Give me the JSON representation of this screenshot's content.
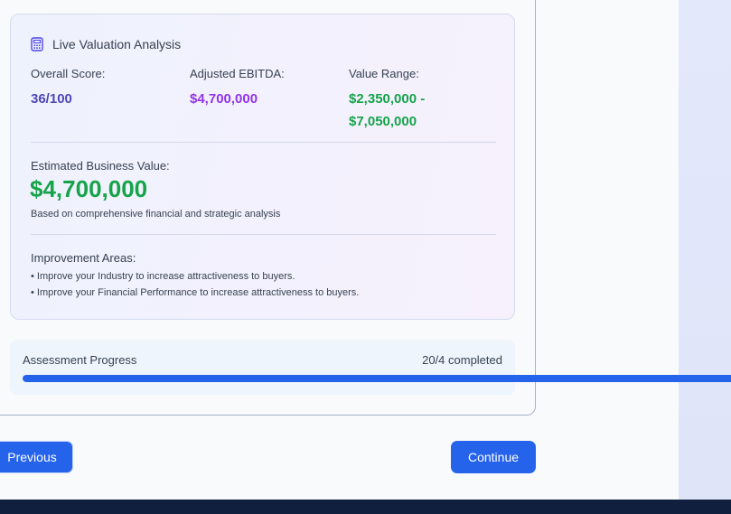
{
  "valuation": {
    "title": "Live Valuation Analysis",
    "icon": "calculator-icon",
    "overall_score_label": "Overall Score:",
    "overall_score_value": "36/100",
    "ebitda_label": "Adjusted EBITDA:",
    "ebitda_value": "$4,700,000",
    "range_label": "Value Range:",
    "range_value_low": "$2,350,000 -",
    "range_value_high": "$7,050,000",
    "estimate_label": "Estimated Business Value:",
    "estimate_value": "$4,700,000",
    "estimate_note": "Based on comprehensive financial and strategic analysis",
    "improvement_label": "Improvement Areas:",
    "improvements": [
      "• Improve your Industry to increase attractiveness to buyers.",
      "• Improve your Financial Performance to increase attractiveness to buyers."
    ]
  },
  "progress": {
    "label": "Assessment Progress",
    "count": "20/4 completed",
    "fraction": 1.0
  },
  "buttons": {
    "previous": "Previous",
    "continue": "Continue"
  },
  "colors": {
    "accent": "#2563eb",
    "score": "#4f46b8",
    "ebitda": "#9333ea",
    "positive": "#16a34a",
    "footer": "#0f1f3d"
  }
}
